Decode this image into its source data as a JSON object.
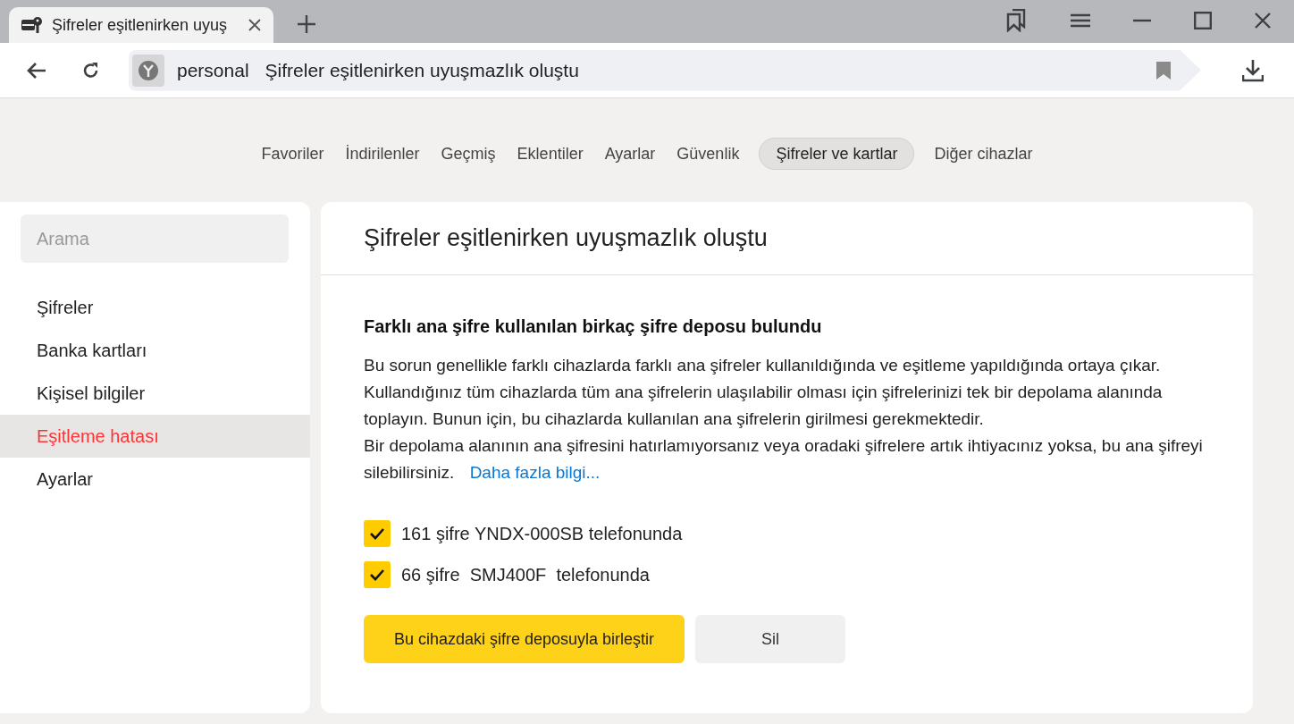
{
  "browser_tab": {
    "title": "Şifreler eşitlenirken uyuş"
  },
  "address_bar": {
    "prefix": "personal",
    "title": "Şifreler eşitlenirken uyuşmazlık oluştu"
  },
  "nav_tabs": [
    {
      "label": "Favoriler",
      "selected": false
    },
    {
      "label": "İndirilenler",
      "selected": false
    },
    {
      "label": "Geçmiş",
      "selected": false
    },
    {
      "label": "Eklentiler",
      "selected": false
    },
    {
      "label": "Ayarlar",
      "selected": false
    },
    {
      "label": "Güvenlik",
      "selected": false
    },
    {
      "label": "Şifreler ve kartlar",
      "selected": true
    },
    {
      "label": "Diğer cihazlar",
      "selected": false
    }
  ],
  "sidebar": {
    "search": {
      "placeholder": "Arama"
    },
    "items": [
      {
        "label": "Şifreler",
        "selected": false
      },
      {
        "label": "Banka kartları",
        "selected": false
      },
      {
        "label": "Kişisel bilgiler",
        "selected": false
      },
      {
        "label": "Eşitleme hatası",
        "selected": true
      },
      {
        "label": "Ayarlar",
        "selected": false
      }
    ]
  },
  "content": {
    "title": "Şifreler eşitlenirken uyuşmazlık oluştu",
    "heading": "Farklı ana şifre kullanılan birkaç şifre deposu bulundu",
    "paragraphs": [
      {
        "text": "Bu sorun genellikle farklı cihazlarda farklı ana şifreler kullanıldığında ve eşitleme yapıldığında ortaya çıkar."
      },
      {
        "text": "Kullandığınız tüm cihazlarda tüm ana şifrelerin ulaşılabilir olması için şifrelerinizi tek bir depolama alanında toplayın. Bunun için, bu cihazlarda kullanılan ana şifrelerin girilmesi gerekmektedir."
      },
      {
        "text": "Bir depolama alanının ana şifresini hatırlamıyorsanız veya oradaki şifrelere artık ihtiyacınız yoksa, bu ana şifreyi silebilirsiniz.",
        "link": "Daha fazla bilgi..."
      }
    ],
    "storages": [
      {
        "label": "161 şifre YNDX-000SB telefonunda",
        "checked": true
      },
      {
        "label": "66 şifre  SMJ400F  telefonunda",
        "checked": true
      }
    ],
    "buttons": [
      {
        "label": "Bu cihazdaki şifre deposuyla birleştir",
        "kind": "primary"
      },
      {
        "label": "Sil",
        "kind": "secondary"
      }
    ]
  }
}
